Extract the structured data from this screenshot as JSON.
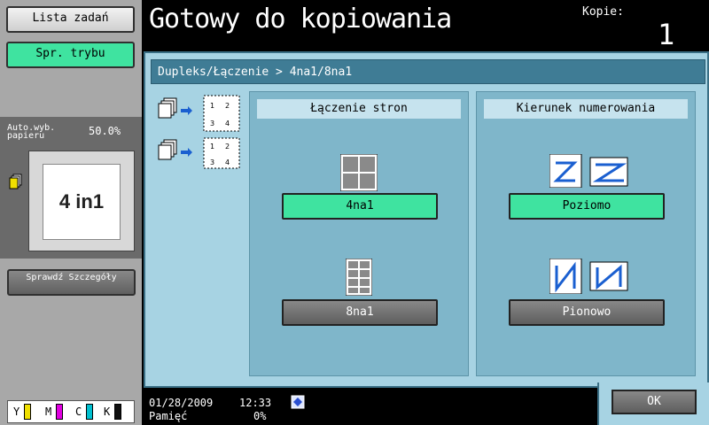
{
  "left": {
    "jobs_label": "Lista zadań",
    "mode_label": "Spr. trybu",
    "autopaper_label": "Auto.wyb. papieru",
    "zoom": "50.0%",
    "preview_text": "4 in1",
    "details_label": "Sprawdź Szczegóły",
    "toners": [
      "Y",
      "M",
      "C",
      "K"
    ],
    "toner_colors": [
      "#f0e000",
      "#e000e0",
      "#00c0d0",
      "#101010"
    ]
  },
  "header": {
    "title": "Gotowy do kopiowania",
    "copies_label": "Kopie:",
    "copies_value": "1"
  },
  "main": {
    "breadcrumb": "Dupleks/Łączenie > 4na1/8na1",
    "combine": {
      "heading": "Łączenie stron",
      "options": [
        {
          "label": "4na1",
          "selected": true,
          "icon": "grid-2x2-icon"
        },
        {
          "label": "8na1",
          "selected": false,
          "icon": "grid-2x4-icon"
        }
      ]
    },
    "order": {
      "heading": "Kierunek numerowania",
      "options": [
        {
          "label": "Poziomo",
          "selected": true,
          "icon": "horizontal-order-icon"
        },
        {
          "label": "Pionowo",
          "selected": false,
          "icon": "vertical-order-icon"
        }
      ]
    },
    "side_digits": [
      "1",
      "2",
      "3",
      "4"
    ]
  },
  "footer": {
    "date": "01/28/2009",
    "time": "12:33",
    "memory_label": "Pamięć",
    "memory_value": "0%",
    "ok_label": "OK"
  },
  "colors": {
    "accent_green": "#3fe3a0",
    "panel_blue": "#a7d3e3",
    "header_blue": "#3f7c95"
  }
}
